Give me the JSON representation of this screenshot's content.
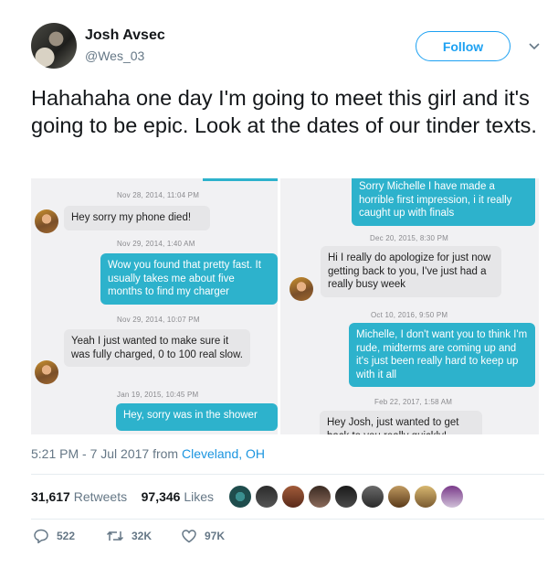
{
  "author": {
    "name": "Josh Avsec",
    "handle": "@Wes_03"
  },
  "follow_label": "Follow",
  "tweet_text": "Hahahaha one day I'm going to meet this girl and it's going to be epic. Look at the dates of our tinder texts.",
  "chat_left": {
    "ts1": "Nov 28, 2014, 11:04 PM",
    "msg1": "Hey sorry my phone died!",
    "ts2": "Nov 29, 2014, 1:40 AM",
    "msg2": "Wow you found that pretty fast. It usually takes me about  five months to find my charger",
    "ts3": "Nov 29, 2014, 10:07 PM",
    "msg3": "Yeah I just wanted to make sure it was fully charged, 0 to 100 real slow.",
    "ts4": "Jan 19, 2015, 10:45 PM",
    "msg4": "Hey, sorry was in the shower"
  },
  "chat_right": {
    "msg0": "Sorry Michelle I have made a horrible first impression, i it really caught up with finals",
    "ts1": "Dec 20, 2015, 8:30 PM",
    "msg1": "Hi I really do apologize for just now getting back to you, I've just had a really busy week",
    "ts2": "Oct 10, 2016, 9:50 PM",
    "msg2": "Michelle, I don't want you to think I'm rude, midterms are coming up and it's just been really hard to keep up with it all",
    "ts3": "Feb 22, 2017, 1:58 AM",
    "msg3": "Hey Josh, just wanted to get back to you really quickly!"
  },
  "meta": {
    "time": "5:21 PM - 7 Jul 2017",
    "from": "from",
    "location": "Cleveland, OH"
  },
  "stats": {
    "retweets_count": "31,617",
    "retweets_label": "Retweets",
    "likes_count": "97,346",
    "likes_label": "Likes"
  },
  "actions": {
    "replies": "522",
    "retweets": "32K",
    "likes": "97K"
  },
  "colors": {
    "accent": "#1da1f2",
    "chat_blue": "#2db2cc",
    "chat_gray": "#e6e6e8"
  }
}
